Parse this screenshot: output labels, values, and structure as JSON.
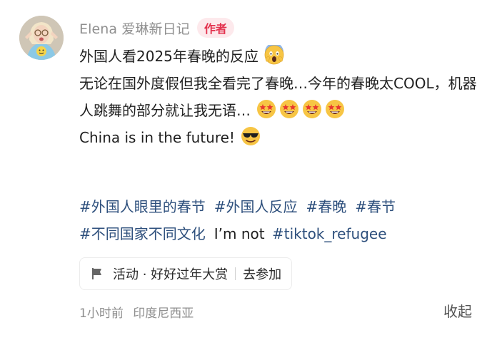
{
  "comment": {
    "username": "Elena 爱琳新日记",
    "author_badge": "作者",
    "title_line": "外国人看2025年春晚的反应",
    "body_part1": "无论在国外度假但我全看完了春晚…今年的春晚太COOL，机器人跳舞的部分就让我无语…",
    "body_line3": "China is in the future! ",
    "hashtags": [
      "#外国人眼里的春节",
      "#外国人反应",
      "#春晚",
      "#春节",
      "#不同国家不同文化"
    ],
    "plain_text": "I’m not ",
    "hashtag_last": "#tiktok_refugee",
    "activity": {
      "label": "活动 · 好好过年大赏",
      "action": "去参加"
    },
    "time": "1小时前",
    "location": "印度尼西亚",
    "collapse_label": "收起"
  },
  "icons": {
    "title_emoji": "screaming-face-icon",
    "star_struck": "star-struck-face-icon",
    "sunglasses": "sunglasses-face-icon",
    "activity": "flag-icon"
  },
  "colors": {
    "tag": "#2d4f7c",
    "badge_bg": "#fde9ec",
    "badge_text": "#e3324e",
    "muted": "#8f8f8f",
    "emoji_yellow": "#f7c544"
  }
}
